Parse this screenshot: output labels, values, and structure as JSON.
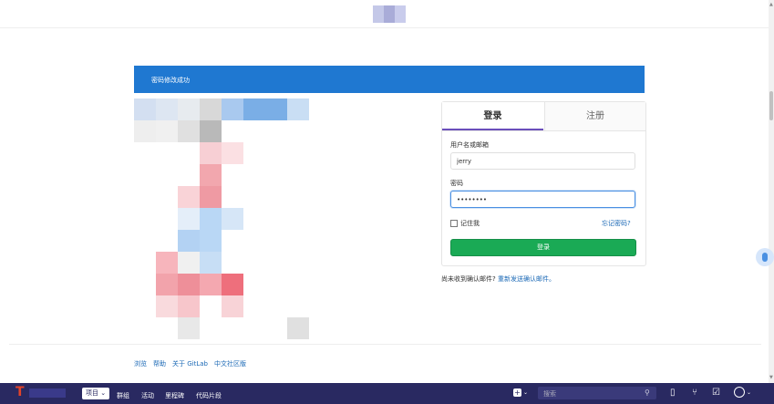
{
  "alert": {
    "message": "密码修改成功"
  },
  "login": {
    "tab_login": "登录",
    "tab_register": "注册",
    "username_label": "用户名或邮箱",
    "username_value": "jerry",
    "password_label": "密码",
    "password_value": "••••••••",
    "remember_label": "记住我",
    "forgot_link": "忘记密码?",
    "submit_label": "登录"
  },
  "confirm": {
    "prefix": "尚未收到确认邮件?",
    "link": "重新发送确认邮件。"
  },
  "footer": {
    "links": [
      "浏览",
      "帮助",
      "关于 GitLab",
      "中文社区版"
    ]
  },
  "navbar": {
    "logo_letter": "T",
    "projects_label": "项目",
    "items": [
      "群组",
      "活动",
      "里程碑",
      "代码片段"
    ],
    "search_placeholder": "搜索"
  },
  "colors": {
    "alert_bg": "#1f78d1",
    "submit_bg": "#1aaa55",
    "navbar_bg": "#292961",
    "link": "#1b69b6"
  },
  "icons": {
    "plus": "plus-square-icon",
    "search": "search-icon",
    "issues": "issues-icon",
    "merge_requests": "merge-request-icon",
    "todos": "todo-icon",
    "avatar": "user-avatar-icon"
  }
}
